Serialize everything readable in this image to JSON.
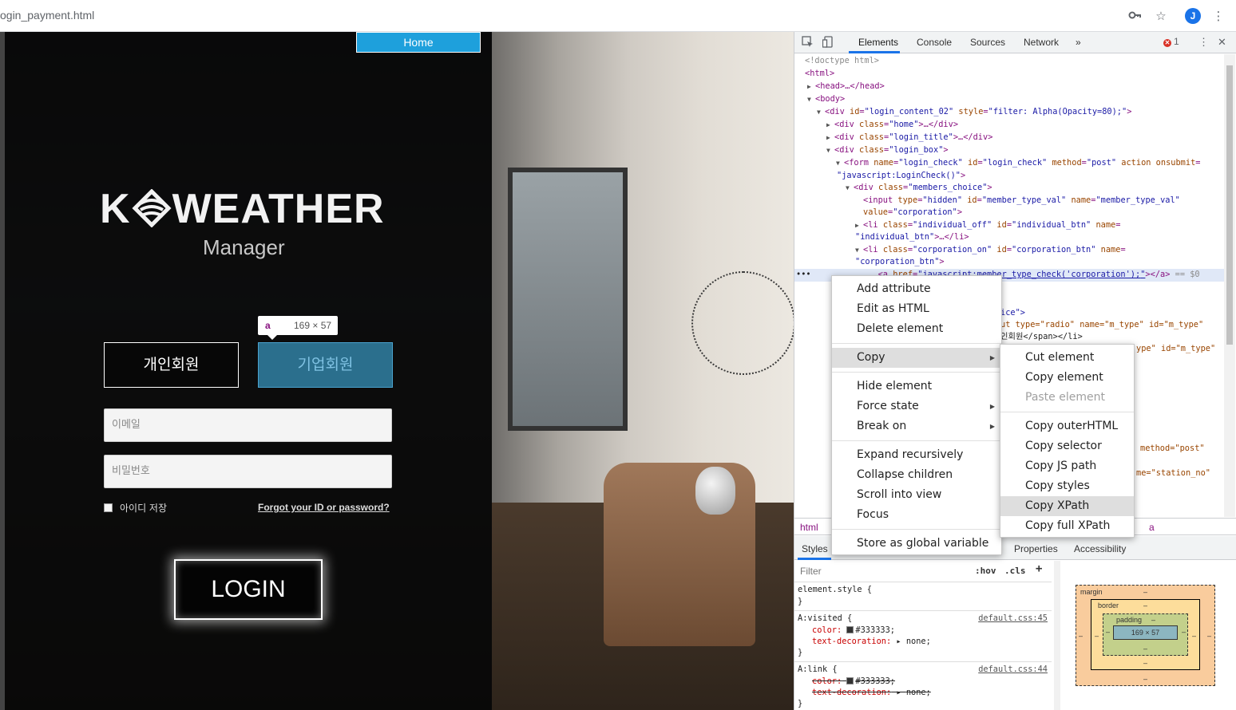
{
  "browser": {
    "url": "ogin_payment.html",
    "avatar_letter": "J",
    "icons": [
      "key-icon",
      "star-icon",
      "kebab-menu-icon"
    ]
  },
  "page": {
    "home_label": "Home",
    "logo_text_left": "K",
    "logo_text_right": "WEATHER",
    "subtitle": "Manager",
    "tooltip_tag": "a",
    "tooltip_dims": "169 × 57",
    "individual_label": "개인회원",
    "corporation_label": "기업회원",
    "email_placeholder": "이메일",
    "password_placeholder": "비밀번호",
    "remember_label": "아이디 저장",
    "forgot_label": "Forgot your ID or password?",
    "login_label": "LOGIN",
    "accent_color": "#1ea0dc"
  },
  "devtools": {
    "tabs": [
      "Elements",
      "Console",
      "Sources",
      "Network"
    ],
    "more_tabs": "»",
    "error_count": "1",
    "breadcrumbs": [
      "html",
      "a"
    ],
    "subtabs": [
      "Styles",
      "Properties",
      "Accessibility"
    ],
    "filter_placeholder": "Filter",
    "hov": ":hov",
    "cls": ".cls",
    "plus": "+",
    "selected_suffix": "== $0",
    "styles": {
      "element_style": "element.style {",
      "close": "}",
      "visited_selector": "A:visited {",
      "visited_src": "default.css:45",
      "visited_color": "#333333;",
      "visited_decoration": "none;",
      "link_selector": "A:link {",
      "link_src": "default.css:44",
      "link_color": "#333333;",
      "link_decoration": "none;",
      "prop_color": "color:",
      "prop_text_decoration": "text-decoration:"
    },
    "box_model": {
      "margin": "margin",
      "border": "border",
      "padding": "padding",
      "content": "169 × 57",
      "dash": "–"
    },
    "dom_fragments": {
      "doctype": "<!doctype html>",
      "html": "<html>",
      "head": "<head>…</head>",
      "body": "<body>",
      "div_login_content": "login_content_02",
      "div_login_style": "filter: Alpha(Opacity=80);",
      "home_class": "home",
      "login_title_class": "login_title",
      "login_box_class": "login_box",
      "form_name": "login_check",
      "form_id": "login_check",
      "form_method": "post",
      "form_onsubmit": "javascript:LoginCheck()",
      "members_choice": "members_choice",
      "input_type": "hidden",
      "input_id": "member_type_val",
      "input_name": "member_type_val",
      "input_value": "corporation",
      "li_off_class": "individual_off",
      "li_off_id": "individual_btn",
      "li_off_name": "individual_btn",
      "li_on_class": "corporation_on",
      "li_on_id": "corporation_btn",
      "li_on_name": "corporation_btn",
      "a_href": "javascript:member_type_check('corporation');",
      "frag_ice": "ice\">",
      "frag_radio": "ut type=\"radio\" name=\"m_type\" id=\"m_type\"",
      "frag_korean": "인회원</span></li>",
      "frag_type2": "ype\" id=\"m_type\"",
      "frag_method": "method=\"post\"",
      "frag_station": "me=\"station_no\""
    }
  },
  "context_menu": {
    "items": [
      "Add attribute",
      "Edit as HTML",
      "Delete element",
      "Copy",
      "Hide element",
      "Force state",
      "Break on",
      "Expand recursively",
      "Collapse children",
      "Scroll into view",
      "Focus",
      "Store as global variable"
    ],
    "submenu": [
      "Cut element",
      "Copy element",
      "Paste element",
      "Copy outerHTML",
      "Copy selector",
      "Copy JS path",
      "Copy styles",
      "Copy XPath",
      "Copy full XPath"
    ]
  }
}
